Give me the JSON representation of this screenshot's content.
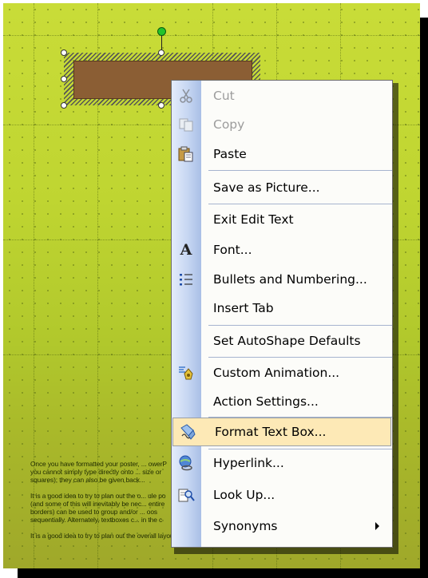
{
  "context_menu": {
    "items": [
      {
        "label": "Cut",
        "icon": "scissors-icon",
        "enabled": false
      },
      {
        "label": "Copy",
        "icon": "copy-icon",
        "enabled": false
      },
      {
        "label": "Paste",
        "icon": "paste-icon",
        "enabled": true
      },
      {
        "label": "Save as Picture...",
        "icon": "",
        "enabled": true
      },
      {
        "label": "Exit Edit Text",
        "icon": "",
        "enabled": true
      },
      {
        "label": "Font...",
        "icon": "font-icon",
        "enabled": true
      },
      {
        "label": "Bullets and Numbering...",
        "icon": "bullets-icon",
        "enabled": true
      },
      {
        "label": "Insert Tab",
        "icon": "",
        "enabled": true
      },
      {
        "label": "Set AutoShape Defaults",
        "icon": "",
        "enabled": true
      },
      {
        "label": "Custom Animation...",
        "icon": "animation-icon",
        "enabled": true
      },
      {
        "label": "Action Settings...",
        "icon": "",
        "enabled": true
      },
      {
        "label": "Format Text Box...",
        "icon": "format-text-box-icon",
        "enabled": true,
        "highlighted": true
      },
      {
        "label": "Hyperlink...",
        "icon": "hyperlink-icon",
        "enabled": true
      },
      {
        "label": "Look Up...",
        "icon": "look-up-icon",
        "enabled": true
      },
      {
        "label": "Synonyms",
        "icon": "",
        "enabled": true,
        "submenu": true
      }
    ]
  },
  "slide_text": {
    "p1_line1": "Once you have formatted your post­er, ... owerP",
    "p1_line2": "you cannot simply type directly onto ... size or",
    "p1_line3": "squares); they can also be given back...",
    "p2_line1": "It is a good idea to try to plan out the o... ule po",
    "p2_line2": "(and some of this will inevitably be nec... entire",
    "p2_line3": "borders) can be used to group and/or ... oos",
    "p2_line4": "sequentially. Alternately, textboxes c... in the c",
    "p3_line1": "It is a good idea to try to plan out the overall layout of your textboxes in advance, although this is quite po"
  },
  "colors": {
    "slide_bg": "#bfd531",
    "shape_fill": "#8b5e34",
    "menu_highlight": "#fde9b6",
    "rotation_handle": "#22c42b"
  }
}
